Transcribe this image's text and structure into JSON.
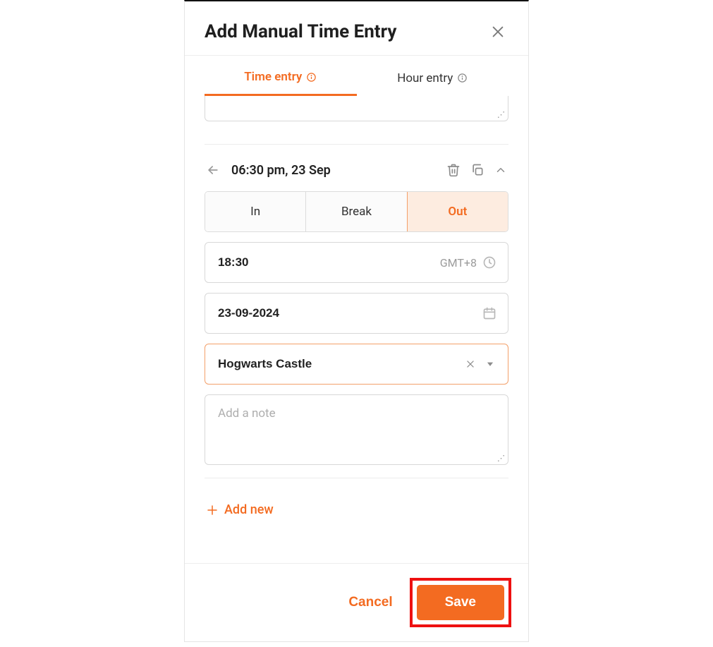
{
  "modal": {
    "title": "Add Manual Time Entry",
    "tabs": {
      "time_entry": "Time entry",
      "hour_entry": "Hour entry"
    },
    "entry": {
      "summary": "06:30 pm, 23 Sep",
      "segments": {
        "in": "In",
        "break": "Break",
        "out": "Out"
      },
      "time_value": "18:30",
      "timezone": "GMT+8",
      "date_value": "23-09-2024",
      "location_value": "Hogwarts Castle",
      "note_placeholder": "Add a note"
    },
    "add_new": "Add new",
    "footer": {
      "cancel": "Cancel",
      "save": "Save"
    }
  }
}
